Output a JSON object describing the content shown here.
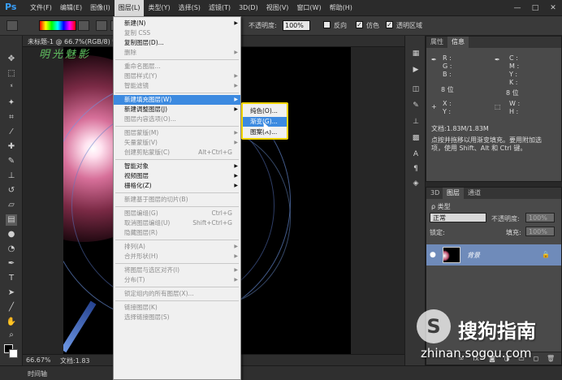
{
  "app": {
    "logo": "Ps"
  },
  "menubar": {
    "items": [
      "文件(F)",
      "编辑(E)",
      "图像(I)",
      "图层(L)",
      "类型(Y)",
      "选择(S)",
      "滤镜(T)",
      "3D(D)",
      "视图(V)",
      "窗口(W)",
      "帮助(H)"
    ],
    "active_index": 3,
    "window_controls": [
      "—",
      "□",
      "✕"
    ]
  },
  "options": {
    "opacity_label": "不透明度:",
    "opacity_value": "100%",
    "reverse_label": "反向",
    "dither_label": "仿色",
    "transparency_label": "透明区域"
  },
  "document": {
    "tab_title": "未标题-1 @ 66.7%(RGB/8) *",
    "zoom": "66.67%",
    "doc_size": "文档:1.83",
    "watermark": "明光魅影"
  },
  "timeline": {
    "label": "时间轴"
  },
  "info_panel": {
    "tabs": [
      "属性",
      "信息"
    ],
    "active_tab": 1,
    "r": "R :",
    "g": "G :",
    "b": "B :",
    "c": "C :",
    "m": "M :",
    "y": "Y :",
    "k": "K :",
    "bits_left": "8 位",
    "bits_right": "8 位",
    "x": "X :",
    "y_coord": "Y :",
    "w": "W :",
    "h": "H :",
    "doc": "文档:1.83M/1.83M",
    "hint_line1": "点按并拖移以用渐变填充。要用附加选",
    "hint_line2": "项，使用 Shift、Alt 和 Ctrl 键。"
  },
  "layers_panel": {
    "tabs": [
      "3D",
      "图层",
      "通道"
    ],
    "active_tab": 1,
    "filter_label": "ρ 类型",
    "blend_mode": "正常",
    "opacity_label": "不透明度:",
    "opacity_value": "100%",
    "lock_label": "锁定:",
    "fill_label": "填充:",
    "fill_value": "100%",
    "layer_name": "背景",
    "footer_icons": [
      "link-icon",
      "fx-icon",
      "mask-icon",
      "adjust-icon",
      "folder-icon",
      "new-layer-icon",
      "trash-icon"
    ]
  },
  "layer_menu": {
    "items": [
      {
        "label": "新建(N)",
        "shortcut": "",
        "arrow": true,
        "disabled": false
      },
      {
        "label": "复制 CSS",
        "shortcut": "",
        "arrow": false,
        "disabled": true
      },
      {
        "label": "复制图层(D)...",
        "shortcut": "",
        "arrow": false,
        "disabled": false
      },
      {
        "label": "删除",
        "shortcut": "",
        "arrow": true,
        "disabled": true
      },
      {
        "sep": true
      },
      {
        "label": "重命名图层...",
        "shortcut": "",
        "arrow": false,
        "disabled": true
      },
      {
        "label": "图层样式(Y)",
        "shortcut": "",
        "arrow": true,
        "disabled": true
      },
      {
        "label": "智能滤镜",
        "shortcut": "",
        "arrow": true,
        "disabled": true
      },
      {
        "sep": true
      },
      {
        "label": "新建填充图层(W)",
        "shortcut": "",
        "arrow": true,
        "disabled": false,
        "highlight": true
      },
      {
        "label": "新建调整图层(J)",
        "shortcut": "",
        "arrow": true,
        "disabled": false
      },
      {
        "label": "图层内容选项(O)...",
        "shortcut": "",
        "arrow": false,
        "disabled": true
      },
      {
        "sep": true
      },
      {
        "label": "图层蒙版(M)",
        "shortcut": "",
        "arrow": true,
        "disabled": true
      },
      {
        "label": "矢量蒙版(V)",
        "shortcut": "",
        "arrow": true,
        "disabled": true
      },
      {
        "label": "创建剪贴蒙版(C)",
        "shortcut": "Alt+Ctrl+G",
        "arrow": false,
        "disabled": true
      },
      {
        "sep": true
      },
      {
        "label": "智能对象",
        "shortcut": "",
        "arrow": true,
        "disabled": false
      },
      {
        "label": "视频图层",
        "shortcut": "",
        "arrow": true,
        "disabled": false
      },
      {
        "label": "栅格化(Z)",
        "shortcut": "",
        "arrow": true,
        "disabled": false
      },
      {
        "sep": true
      },
      {
        "label": "新建基于图层的切片(B)",
        "shortcut": "",
        "arrow": false,
        "disabled": true
      },
      {
        "sep": true
      },
      {
        "label": "图层编组(G)",
        "shortcut": "Ctrl+G",
        "arrow": false,
        "disabled": true
      },
      {
        "label": "取消图层编组(U)",
        "shortcut": "Shift+Ctrl+G",
        "arrow": false,
        "disabled": true
      },
      {
        "label": "隐藏图层(R)",
        "shortcut": "",
        "arrow": false,
        "disabled": true
      },
      {
        "sep": true
      },
      {
        "label": "排列(A)",
        "shortcut": "",
        "arrow": true,
        "disabled": true
      },
      {
        "label": "合并形状(H)",
        "shortcut": "",
        "arrow": true,
        "disabled": true
      },
      {
        "sep": true
      },
      {
        "label": "将图层与选区对齐(I)",
        "shortcut": "",
        "arrow": true,
        "disabled": true
      },
      {
        "label": "分布(T)",
        "shortcut": "",
        "arrow": true,
        "disabled": true
      },
      {
        "sep": true
      },
      {
        "label": "锁定组内的所有图层(X)...",
        "shortcut": "",
        "arrow": false,
        "disabled": true
      },
      {
        "sep": true
      },
      {
        "label": "链接图层(K)",
        "shortcut": "",
        "arrow": false,
        "disabled": true
      },
      {
        "label": "选择链接图层(S)",
        "shortcut": "",
        "arrow": false,
        "disabled": true
      }
    ]
  },
  "fill_submenu": {
    "items": [
      "纯色(O)...",
      "渐变(G)...",
      "图案(R)..."
    ],
    "highlight_index": 1
  },
  "watermark": {
    "logo_letter": "S",
    "title": "搜狗指南",
    "url": "zhinan.sogou.com"
  }
}
